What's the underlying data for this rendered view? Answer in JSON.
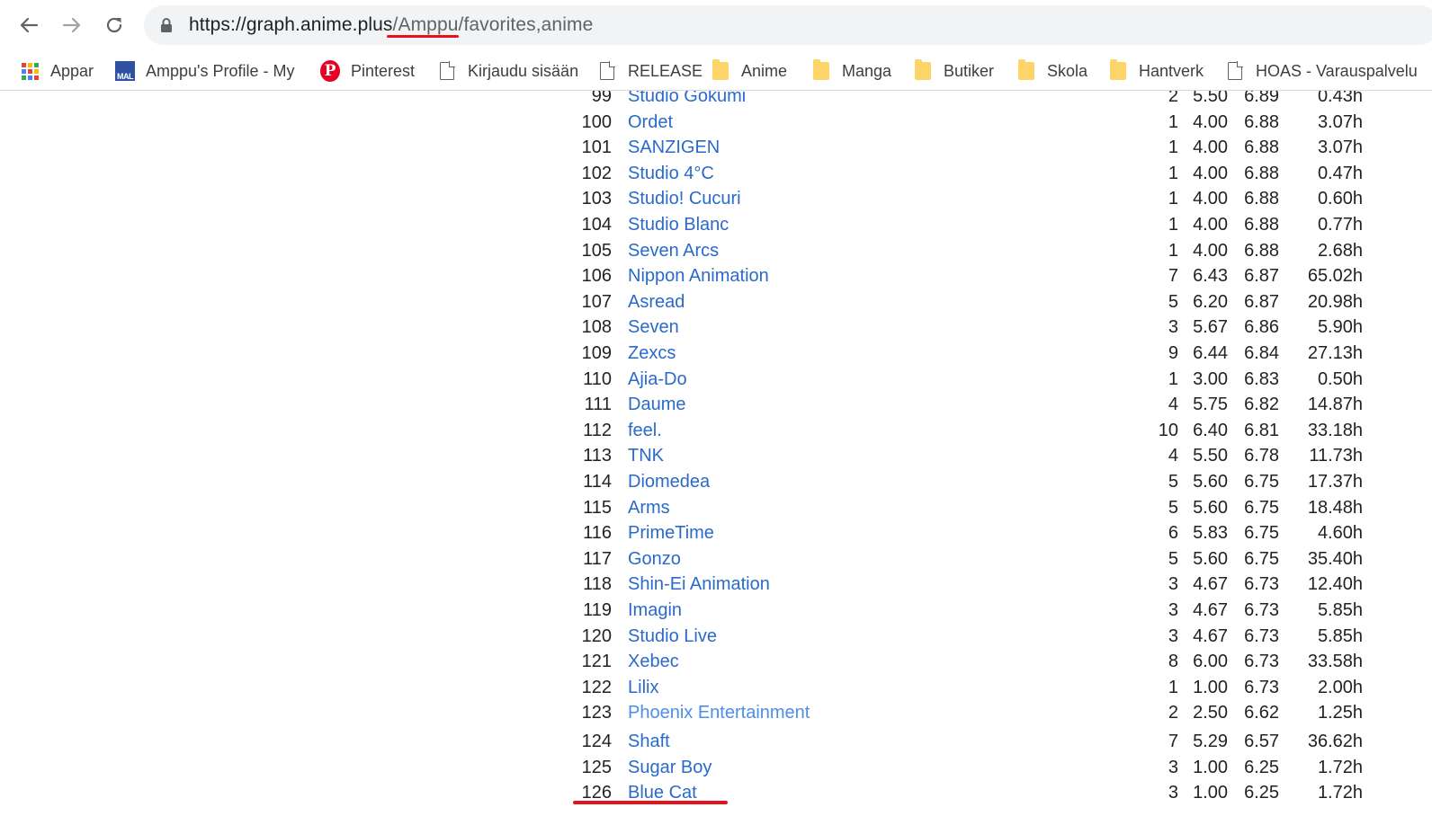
{
  "browser": {
    "url_prefix": "https://graph.anime.plus",
    "url_user": "/Amppu",
    "url_rest": "/favorites,anime"
  },
  "bookmarks": [
    {
      "label": "Appar",
      "icon": "apps-grid-icon"
    },
    {
      "label": "Amppu's Profile - My",
      "icon": "mal-icon"
    },
    {
      "label": "Pinterest",
      "icon": "pinterest-icon"
    },
    {
      "label": "Kirjaudu sisään",
      "icon": "page-icon"
    },
    {
      "label": "RELEASE",
      "icon": "page-icon"
    },
    {
      "label": "Anime",
      "icon": "folder-icon"
    },
    {
      "label": "Manga",
      "icon": "folder-icon"
    },
    {
      "label": "Butiker",
      "icon": "folder-icon"
    },
    {
      "label": "Skola",
      "icon": "folder-icon"
    },
    {
      "label": "Hantverk",
      "icon": "folder-icon"
    },
    {
      "label": "HOAS - Varauspalvelu",
      "icon": "page-icon"
    }
  ],
  "studios": [
    {
      "rank": "99",
      "name": "Studio Gokumi",
      "count": "2",
      "mean": "5.50",
      "weighted": "6.89",
      "time": "0.43h"
    },
    {
      "rank": "100",
      "name": "Ordet",
      "count": "1",
      "mean": "4.00",
      "weighted": "6.88",
      "time": "3.07h"
    },
    {
      "rank": "101",
      "name": "SANZIGEN",
      "count": "1",
      "mean": "4.00",
      "weighted": "6.88",
      "time": "3.07h"
    },
    {
      "rank": "102",
      "name": "Studio 4°C",
      "count": "1",
      "mean": "4.00",
      "weighted": "6.88",
      "time": "0.47h"
    },
    {
      "rank": "103",
      "name": "Studio! Cucuri",
      "count": "1",
      "mean": "4.00",
      "weighted": "6.88",
      "time": "0.60h"
    },
    {
      "rank": "104",
      "name": "Studio Blanc",
      "count": "1",
      "mean": "4.00",
      "weighted": "6.88",
      "time": "0.77h"
    },
    {
      "rank": "105",
      "name": "Seven Arcs",
      "count": "1",
      "mean": "4.00",
      "weighted": "6.88",
      "time": "2.68h"
    },
    {
      "rank": "106",
      "name": "Nippon Animation",
      "count": "7",
      "mean": "6.43",
      "weighted": "6.87",
      "time": "65.02h"
    },
    {
      "rank": "107",
      "name": "Asread",
      "count": "5",
      "mean": "6.20",
      "weighted": "6.87",
      "time": "20.98h"
    },
    {
      "rank": "108",
      "name": "Seven",
      "count": "3",
      "mean": "5.67",
      "weighted": "6.86",
      "time": "5.90h"
    },
    {
      "rank": "109",
      "name": "Zexcs",
      "count": "9",
      "mean": "6.44",
      "weighted": "6.84",
      "time": "27.13h"
    },
    {
      "rank": "110",
      "name": "Ajia-Do",
      "count": "1",
      "mean": "3.00",
      "weighted": "6.83",
      "time": "0.50h"
    },
    {
      "rank": "111",
      "name": "Daume",
      "count": "4",
      "mean": "5.75",
      "weighted": "6.82",
      "time": "14.87h"
    },
    {
      "rank": "112",
      "name": "feel.",
      "count": "10",
      "mean": "6.40",
      "weighted": "6.81",
      "time": "33.18h"
    },
    {
      "rank": "113",
      "name": "TNK",
      "count": "4",
      "mean": "5.50",
      "weighted": "6.78",
      "time": "11.73h"
    },
    {
      "rank": "114",
      "name": "Diomedea",
      "count": "5",
      "mean": "5.60",
      "weighted": "6.75",
      "time": "17.37h"
    },
    {
      "rank": "115",
      "name": "Arms",
      "count": "5",
      "mean": "5.60",
      "weighted": "6.75",
      "time": "18.48h"
    },
    {
      "rank": "116",
      "name": "PrimeTime",
      "count": "6",
      "mean": "5.83",
      "weighted": "6.75",
      "time": "4.60h"
    },
    {
      "rank": "117",
      "name": "Gonzo",
      "count": "5",
      "mean": "5.60",
      "weighted": "6.75",
      "time": "35.40h"
    },
    {
      "rank": "118",
      "name": "Shin-Ei Animation",
      "count": "3",
      "mean": "4.67",
      "weighted": "6.73",
      "time": "12.40h"
    },
    {
      "rank": "119",
      "name": "Imagin",
      "count": "3",
      "mean": "4.67",
      "weighted": "6.73",
      "time": "5.85h"
    },
    {
      "rank": "120",
      "name": "Studio Live",
      "count": "3",
      "mean": "4.67",
      "weighted": "6.73",
      "time": "5.85h"
    },
    {
      "rank": "121",
      "name": "Xebec",
      "count": "8",
      "mean": "6.00",
      "weighted": "6.73",
      "time": "33.58h"
    },
    {
      "rank": "122",
      "name": "Lilix",
      "count": "1",
      "mean": "1.00",
      "weighted": "6.73",
      "time": "2.00h"
    },
    {
      "rank": "123",
      "name": "Phoenix Entertainment",
      "count": "2",
      "mean": "2.50",
      "weighted": "6.62",
      "time": "1.25h"
    },
    {
      "rank": "124",
      "name": "Shaft",
      "count": "7",
      "mean": "5.29",
      "weighted": "6.57",
      "time": "36.62h"
    },
    {
      "rank": "125",
      "name": "Sugar Boy",
      "count": "3",
      "mean": "1.00",
      "weighted": "6.25",
      "time": "1.72h"
    },
    {
      "rank": "126",
      "name": "Blue Cat",
      "count": "3",
      "mean": "1.00",
      "weighted": "6.25",
      "time": "1.72h"
    }
  ]
}
